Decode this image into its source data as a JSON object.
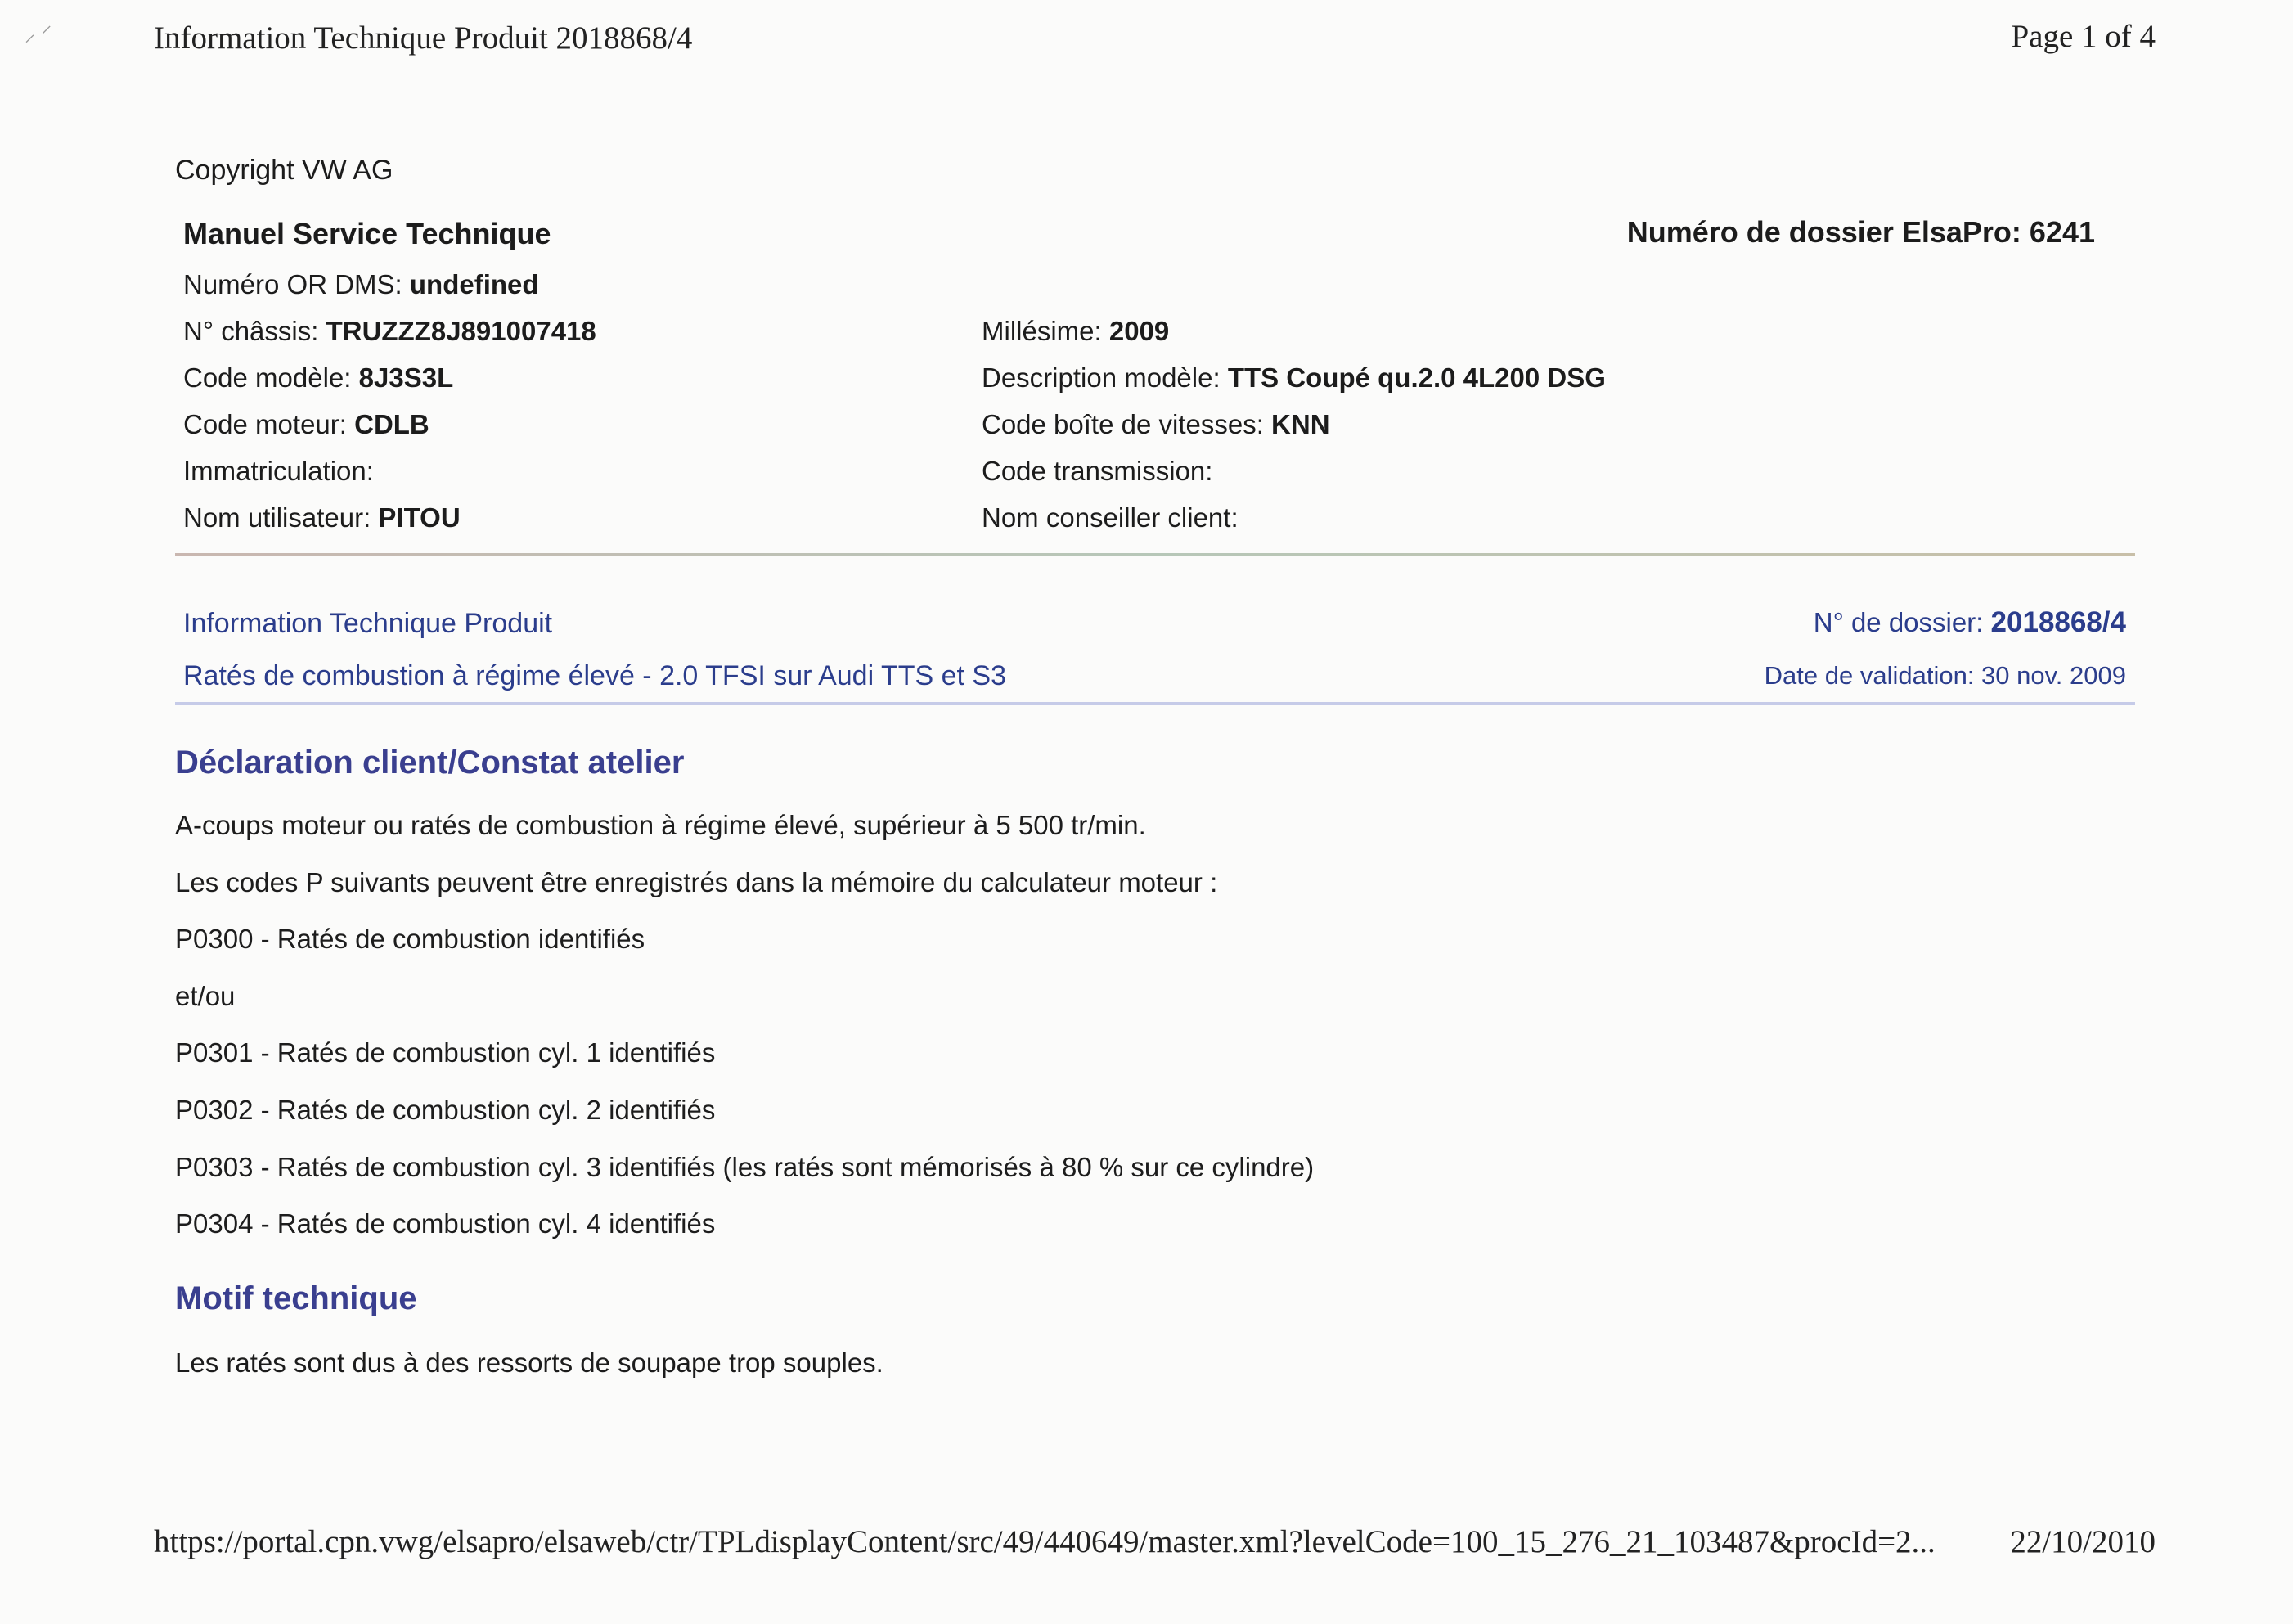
{
  "print_header": {
    "title": "Information Technique Produit 2018868/4",
    "page": "Page 1 of 4"
  },
  "print_footer": {
    "url": "https://portal.cpn.vwg/elsapro/elsaweb/ctr/TPLdisplayContent/src/49/440649/master.xml?levelCode=100_15_276_21_103487&procId=2...",
    "date": "22/10/2010"
  },
  "copyright": "Copyright VW AG",
  "manual": {
    "title": "Manuel Service Technique",
    "elsapro": "Numéro de dossier ElsaPro: 6241"
  },
  "fields_left": [
    {
      "label": "Numéro OR DMS: ",
      "value": "undefined"
    },
    {
      "label": "N° châssis: ",
      "value": "TRUZZZ8J891007418"
    },
    {
      "label": "Code modèle: ",
      "value": "8J3S3L"
    },
    {
      "label": "Code moteur: ",
      "value": "CDLB"
    },
    {
      "label": "Immatriculation:",
      "value": ""
    },
    {
      "label": "Nom utilisateur: ",
      "value": "PITOU"
    }
  ],
  "fields_right": [
    {
      "label": "Millésime: ",
      "value": "2009"
    },
    {
      "label": "Description modèle: ",
      "value": "TTS Coupé qu.2.0 4L200 DSG"
    },
    {
      "label": "Code boîte de vitesses: ",
      "value": "KNN"
    },
    {
      "label": "Code transmission:",
      "value": ""
    },
    {
      "label": "Nom conseiller client:",
      "value": ""
    }
  ],
  "info": {
    "label": "Information Technique Produit",
    "subject": "Ratés de combustion à régime élevé - 2.0 TFSI sur Audi TTS et S3",
    "dossier_label": "N° de dossier: ",
    "dossier_value": "2018868/4",
    "validation": "Date de validation: 30 nov. 2009"
  },
  "declaration": {
    "heading": "Déclaration client/Constat atelier",
    "lines": [
      "A-coups moteur ou ratés de combustion à régime élevé, supérieur à 5 500 tr/min.",
      "Les codes P suivants peuvent être enregistrés dans la mémoire du calculateur moteur :",
      "P0300 - Ratés de combustion identifiés",
      "et/ou",
      "P0301 - Ratés de combustion cyl. 1 identifiés",
      "P0302 - Ratés de combustion cyl. 2 identifiés",
      "P0303 - Ratés de combustion cyl. 3 identifiés (les ratés sont mémorisés à 80 % sur ce cylindre)",
      "P0304 - Ratés de combustion cyl. 4 identifiés"
    ]
  },
  "motif": {
    "heading": "Motif technique",
    "text": "Les ratés sont dus à des ressorts de soupape trop souples."
  }
}
